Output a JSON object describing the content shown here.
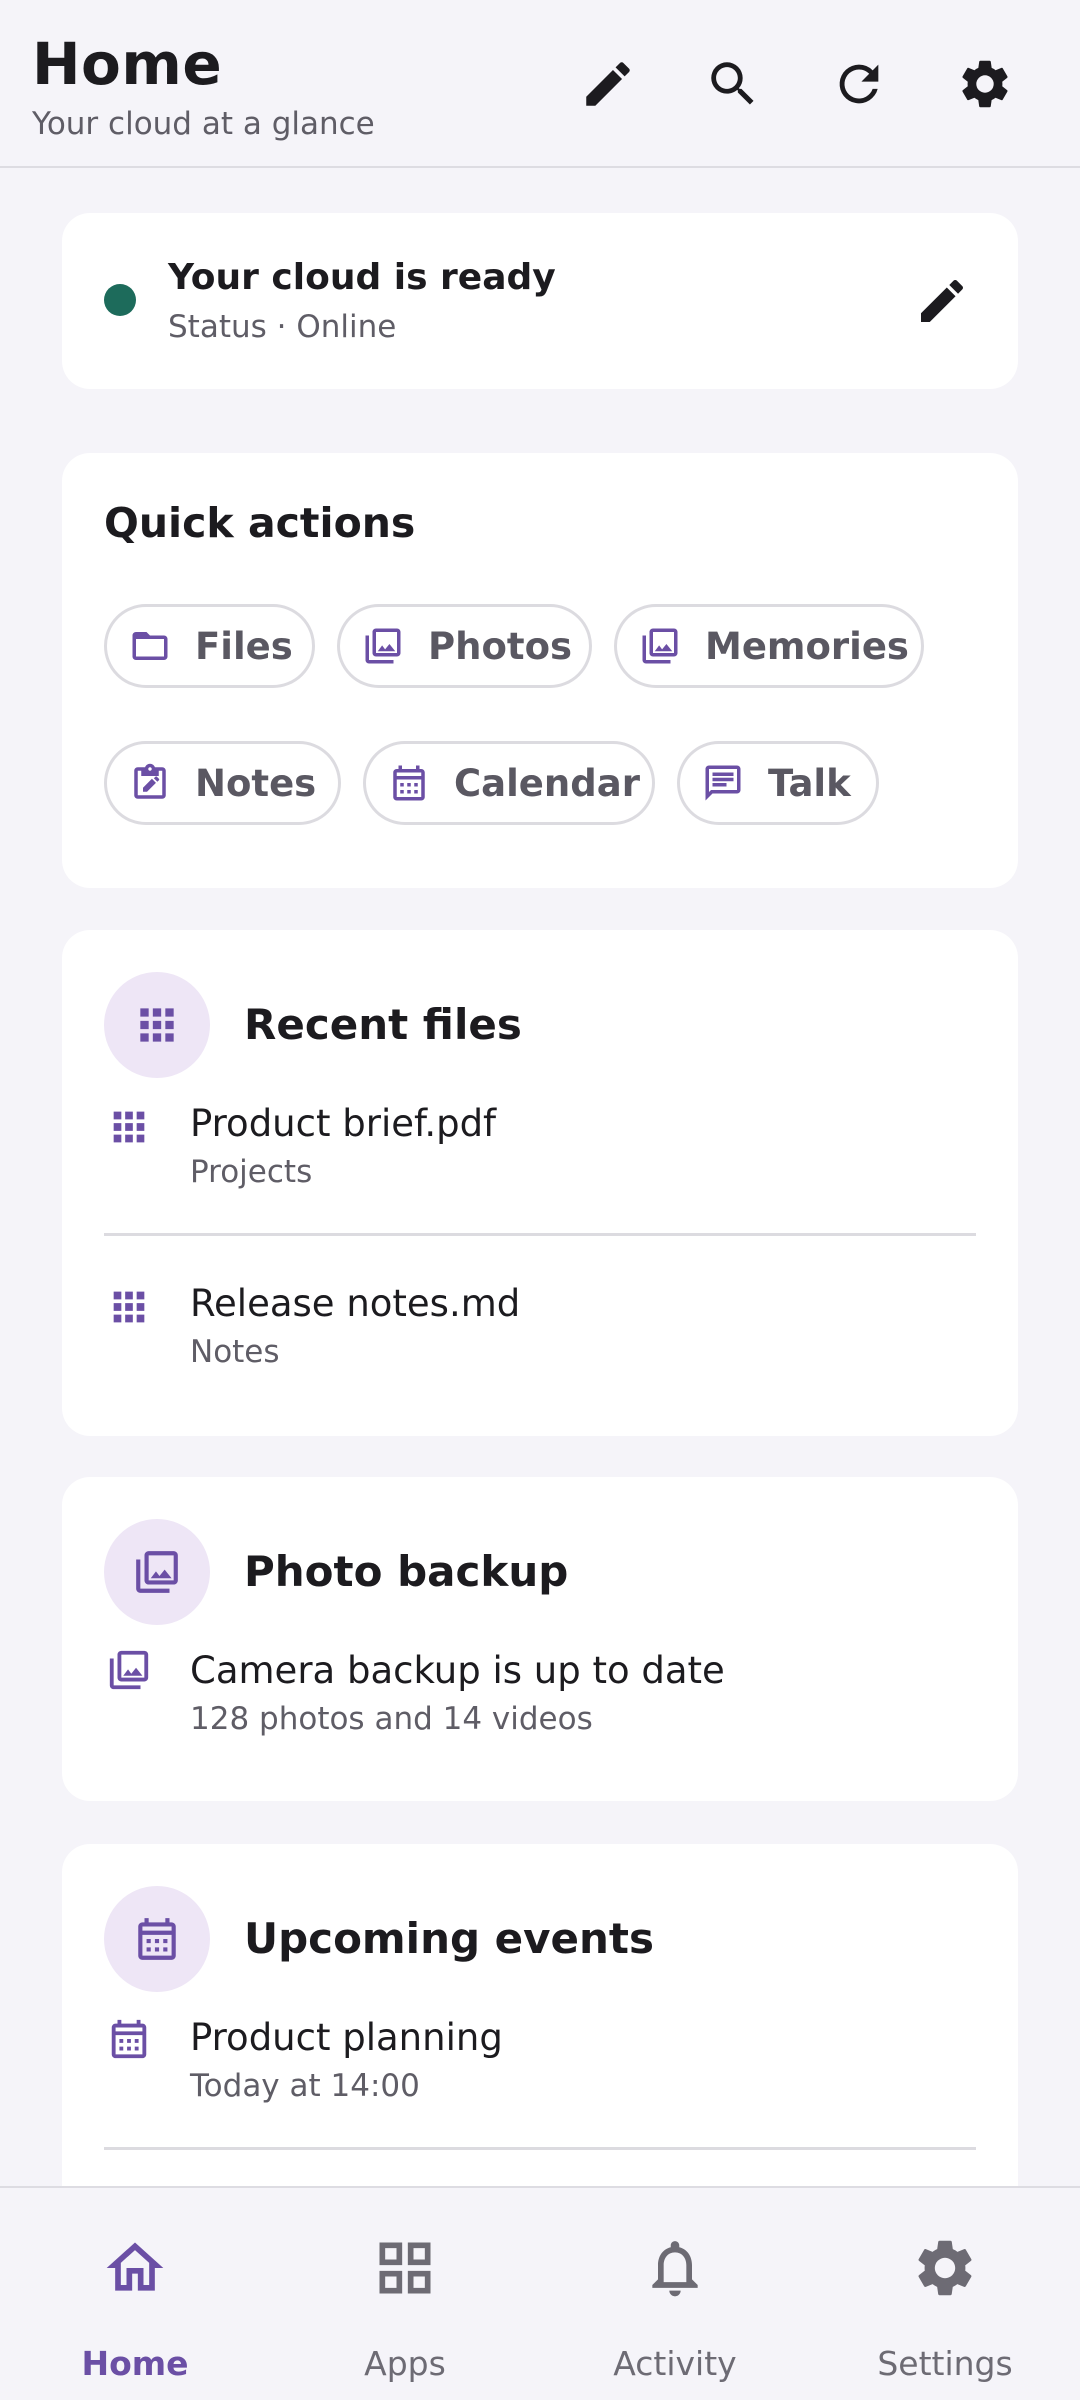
{
  "header": {
    "title": "Home",
    "subtitle": "Your cloud at a glance",
    "actions": [
      "edit-icon",
      "search-icon",
      "refresh-icon",
      "settings-icon"
    ]
  },
  "status": {
    "title": "Your cloud is ready",
    "subtitle": "Status · Online",
    "dot_color": "#1d6b5b"
  },
  "quick_actions": {
    "title": "Quick actions",
    "chips": [
      {
        "label": "Files",
        "icon": "folder-icon"
      },
      {
        "label": "Photos",
        "icon": "photos-icon"
      },
      {
        "label": "Memories",
        "icon": "photos-icon"
      },
      {
        "label": "Notes",
        "icon": "note-edit-icon"
      },
      {
        "label": "Calendar",
        "icon": "calendar-icon"
      },
      {
        "label": "Talk",
        "icon": "chat-icon"
      }
    ]
  },
  "recent_files": {
    "title": "Recent files",
    "items": [
      {
        "name": "Product brief.pdf",
        "folder": "Projects"
      },
      {
        "name": "Release notes.md",
        "folder": "Notes"
      }
    ]
  },
  "photo_backup": {
    "title": "Photo backup",
    "status": "Camera backup is up to date",
    "detail": "128 photos and 14 videos"
  },
  "events": {
    "title": "Upcoming events",
    "items": [
      {
        "title": "Product planning",
        "time": "Today at 14:00"
      }
    ]
  },
  "nav": {
    "items": [
      {
        "label": "Home",
        "icon": "home-icon",
        "active": true
      },
      {
        "label": "Apps",
        "icon": "apps-icon",
        "active": false
      },
      {
        "label": "Activity",
        "icon": "bell-icon",
        "active": false
      },
      {
        "label": "Settings",
        "icon": "settings-icon",
        "active": false
      }
    ]
  },
  "colors": {
    "accent": "#6b4fa5",
    "accent_container": "#eee6f6",
    "background": "#f5f4f9",
    "card": "#ffffff",
    "status_online": "#1d6b5b"
  }
}
